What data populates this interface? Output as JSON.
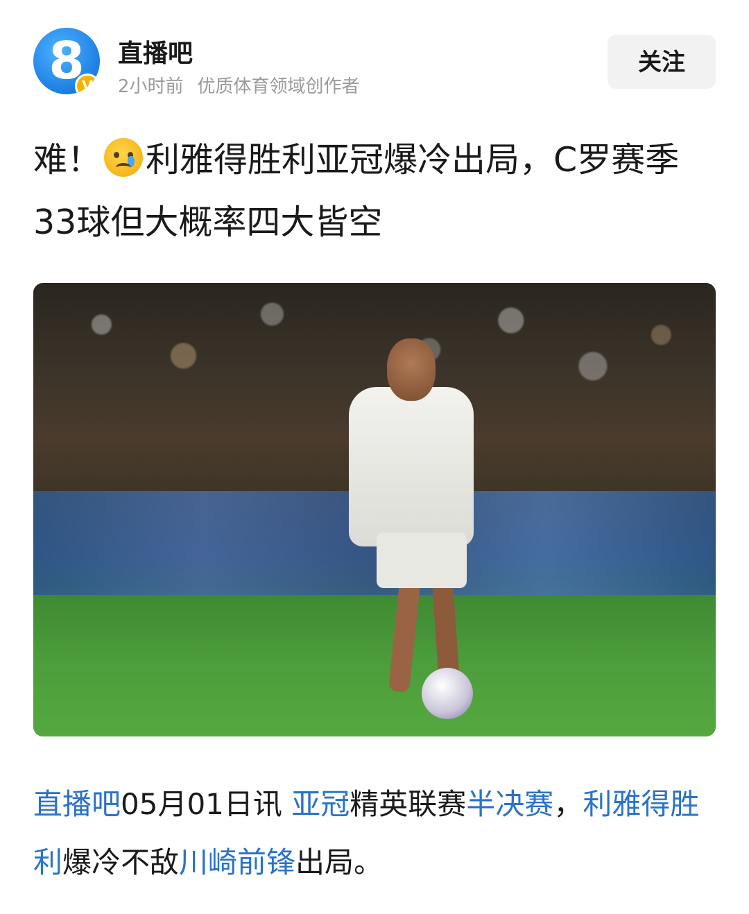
{
  "header": {
    "avatar_number": "8",
    "verified_badge": "V",
    "author": "直播吧",
    "time_ago": "2小时前",
    "author_desc": "优质体育领域创作者",
    "follow_label": "关注"
  },
  "article": {
    "title_prefix": "难！",
    "title_emoji": "crying-face-emoji",
    "title_rest": "利雅得胜利亚冠爆冷出局，C罗赛季33球但大概率四大皆空",
    "body": [
      {
        "text": "直播吧",
        "link": true
      },
      {
        "text": "05月01日讯 ",
        "link": false
      },
      {
        "text": "亚冠",
        "link": true
      },
      {
        "text": "精英联赛",
        "link": false
      },
      {
        "text": "半决赛",
        "link": true
      },
      {
        "text": "，",
        "link": false
      },
      {
        "text": "利雅得胜利",
        "link": true
      },
      {
        "text": "爆冷不敌",
        "link": false
      },
      {
        "text": "川崎前锋",
        "link": true
      },
      {
        "text": "出局。",
        "link": false
      }
    ]
  },
  "colors": {
    "link": "#2a73c6",
    "avatar": "#1b7fe3",
    "badge": "#f5b300"
  }
}
